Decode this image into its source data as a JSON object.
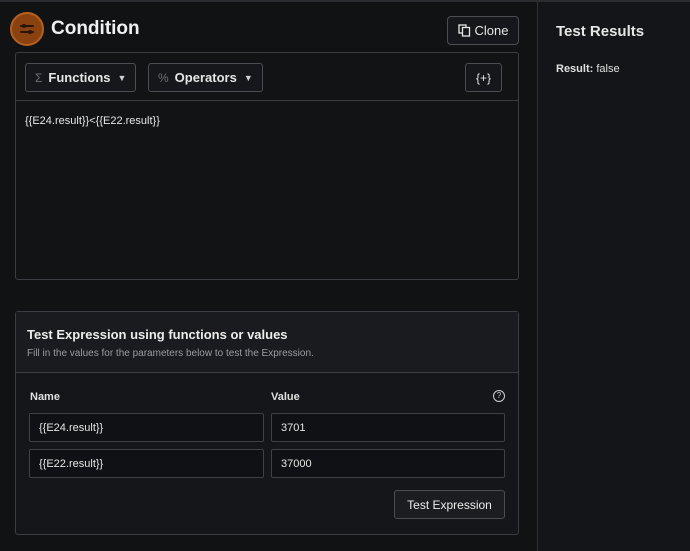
{
  "header": {
    "title": "Condition",
    "clone_label": "Clone",
    "accent_color": "#8a4210"
  },
  "toolbar": {
    "functions_label": "Functions",
    "operators_label": "Operators",
    "insert_var_label": "{+}"
  },
  "editor": {
    "expression": "{{E24.result}}<{{E22.result}}"
  },
  "test": {
    "title": "Test Expression using functions or values",
    "subtitle": "Fill in the values for the parameters below to test the Expression.",
    "col_name": "Name",
    "col_value": "Value",
    "rows": [
      {
        "name": "{{E24.result}}",
        "value": "3701"
      },
      {
        "name": "{{E22.result}}",
        "value": "37000"
      }
    ],
    "button_label": "Test Expression"
  },
  "results": {
    "title": "Test Results",
    "result_label": "Result:",
    "result_value": "false"
  }
}
